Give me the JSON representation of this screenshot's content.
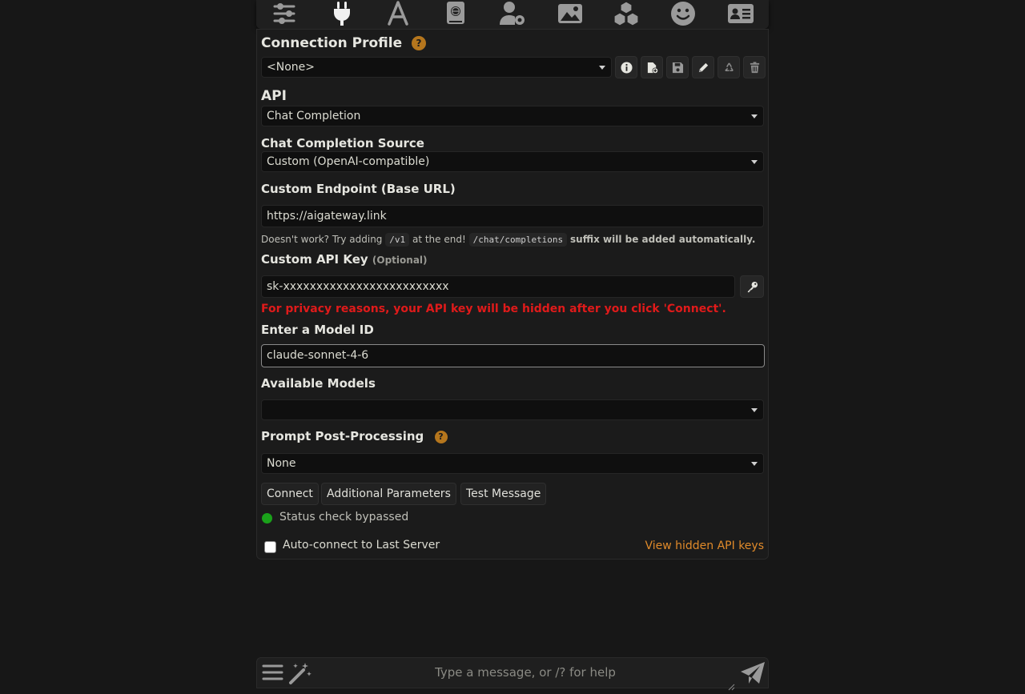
{
  "top_nav": {
    "icons": [
      "sliders-icon",
      "plug-icon",
      "font-icon",
      "book-globe-icon",
      "user-gear-icon",
      "image-icon",
      "cubes-icon",
      "smile-icon",
      "id-card-icon"
    ],
    "active": "plug-icon",
    "accent_color": "#cfcfcf"
  },
  "connection_profile": {
    "title": "Connection Profile",
    "help": "?",
    "selected": "<None>",
    "actions": [
      "info-icon",
      "file-plus-icon",
      "save-icon",
      "pencil-icon",
      "recycle-icon",
      "trash-icon"
    ]
  },
  "api": {
    "label": "API",
    "selected": "Chat Completion"
  },
  "chat_completion_source": {
    "label": "Chat Completion Source",
    "selected": "Custom (OpenAI-compatible)"
  },
  "custom_endpoint": {
    "label": "Custom Endpoint (Base URL)",
    "value": "https://aigateway.link",
    "hint_prefix": "Doesn't work? Try adding",
    "hint_code1": "/v1",
    "hint_middle": "at the end!",
    "hint_code2": "/chat/completions",
    "hint_suffix": "suffix will be added automatically."
  },
  "api_key": {
    "label": "Custom API Key",
    "optional": "(Optional)",
    "value": "sk-xxxxxxxxxxxxxxxxxxxxxxxxx",
    "privacy_warning": "For privacy reasons, your API key will be hidden after you click 'Connect'.",
    "warning_color": "#e01a1a"
  },
  "model_id": {
    "label": "Enter a Model ID",
    "value": "claude-sonnet-4-6"
  },
  "available_models": {
    "label": "Available Models",
    "selected": ""
  },
  "prompt_post_processing": {
    "label": "Prompt Post-Processing",
    "help": "?",
    "selected": "None"
  },
  "buttons": {
    "connect": "Connect",
    "additional_parameters": "Additional Parameters",
    "test_message": "Test Message"
  },
  "status": {
    "text": "Status check bypassed",
    "color": "#1aa11a"
  },
  "auto_connect": {
    "label": "Auto-connect to Last Server",
    "checked": false
  },
  "view_hidden_keys": {
    "label": "View hidden API keys",
    "color": "#e08a2a"
  },
  "chat_input": {
    "placeholder": "Type a message, or /? for help"
  }
}
